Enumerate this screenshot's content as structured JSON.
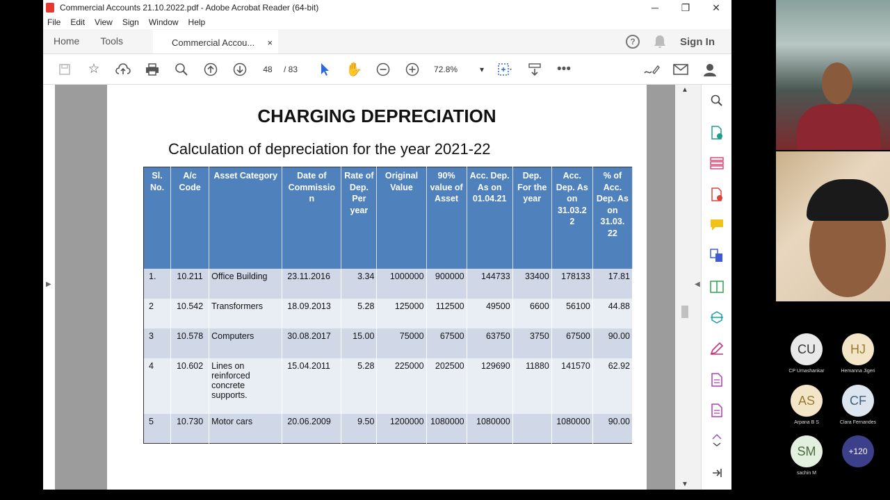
{
  "window": {
    "title": "Commercial Accounts 21.10.2022.pdf - Adobe Acrobat Reader (64-bit)",
    "controls": [
      "─",
      "❐",
      "✕"
    ]
  },
  "menu": [
    "File",
    "Edit",
    "View",
    "Sign",
    "Window",
    "Help"
  ],
  "tabs": {
    "home": "Home",
    "tools": "Tools",
    "document": "Commercial Accou...",
    "close": "×",
    "sign_in": "Sign In",
    "help": "?"
  },
  "toolbar": {
    "current_page": "48",
    "total_pages": "/ 83",
    "zoom": "72.8%"
  },
  "page": {
    "title": "CHARGING DEPRECIATION",
    "subtitle": "Calculation of depreciation for the year 2021-22"
  },
  "table": {
    "headers": [
      "Sl. No.",
      "A/c Code",
      "Asset Category",
      "Date of Commissio n",
      "Rate of Dep. Per year",
      "Original Value",
      "90% value of Asset",
      "Acc. Dep. As on 01.04.21",
      "Dep. For the year",
      "Acc. Dep. As on 31.03.2 2",
      "% of Acc. Dep. As on 31.03. 22"
    ],
    "rows": [
      [
        "1.",
        "10.211",
        "Office Building",
        "23.11.2016",
        "3.34",
        "1000000",
        "900000",
        "144733",
        "33400",
        "178133",
        "17.81"
      ],
      [
        "2",
        "10.542",
        "Transformers",
        "18.09.2013",
        "5.28",
        "125000",
        "112500",
        "49500",
        "6600",
        "56100",
        "44.88"
      ],
      [
        "3",
        "10.578",
        "Computers",
        "30.08.2017",
        "15.00",
        "75000",
        "67500",
        "63750",
        "3750",
        "67500",
        "90.00"
      ],
      [
        "4",
        "10.602",
        "Lines on reinforced concrete supports.",
        "15.04.2011",
        "5.28",
        "225000",
        "202500",
        "129690",
        "11880",
        "141570",
        "62.92"
      ],
      [
        "5",
        "10.730",
        "Motor cars",
        "20.06.2009",
        "9.50",
        "1200000",
        "1080000",
        "1080000",
        "",
        "1080000",
        "90.00"
      ]
    ]
  },
  "participants": [
    {
      "initials": "CU",
      "name": "CP Umashankar",
      "color": "#e9e9e9",
      "text_color": "#333333"
    },
    {
      "initials": "HJ",
      "name": "Hemanna Jigeri",
      "color": "#f3e6c8",
      "text_color": "#9a7a30"
    },
    {
      "initials": "AS",
      "name": "Arpana B S",
      "color": "#f3e6c8",
      "text_color": "#9a7a30"
    },
    {
      "initials": "CF",
      "name": "Clara Fernandes",
      "color": "#dde6ef",
      "text_color": "#40607a"
    },
    {
      "initials": "SM",
      "name": "sachin M",
      "color": "#e3efdf",
      "text_color": "#4a6a40"
    },
    {
      "initials": "+120",
      "name": "",
      "color": "#3c3f8a",
      "text_color": "#ffffff"
    }
  ]
}
